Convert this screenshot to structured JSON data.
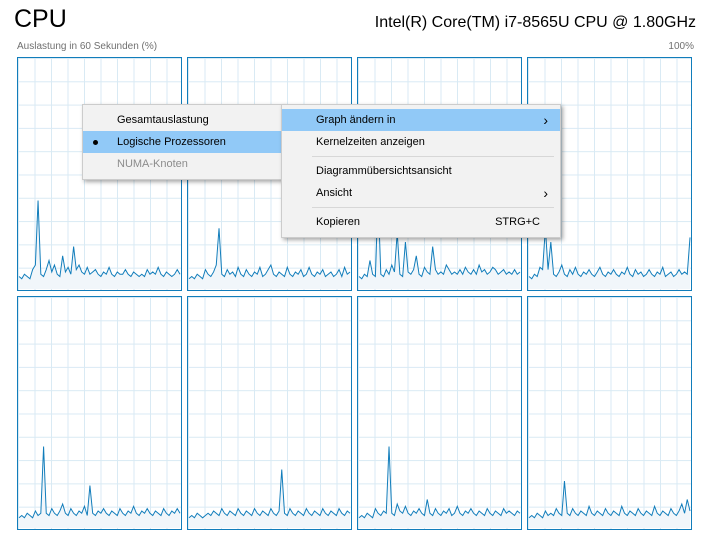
{
  "header": {
    "title": "CPU",
    "cpu_model": "Intel(R) Core(TM) i7-8565U CPU @ 1.80GHz",
    "axis_label": "Auslastung in 60 Sekunden (%)",
    "axis_max": "100%"
  },
  "colors": {
    "graph_line": "#117dbb",
    "graph_fill": "#f1f6fa",
    "grid": "#d9eaf4",
    "menu_highlight": "#91c9f7"
  },
  "graphs": {
    "count": 8,
    "columns": 4,
    "series": [
      [
        5,
        4,
        6,
        5,
        4,
        8,
        10,
        38,
        6,
        5,
        8,
        12,
        7,
        10,
        6,
        5,
        14,
        7,
        9,
        6,
        18,
        8,
        10,
        7,
        6,
        9,
        6,
        7,
        8,
        6,
        5,
        7,
        6,
        9,
        6,
        5,
        7,
        6,
        6,
        8,
        6,
        5,
        7,
        6,
        5,
        6,
        5,
        8,
        6,
        7,
        6,
        9,
        6,
        5,
        7,
        6,
        5,
        6,
        8,
        6
      ],
      [
        4,
        5,
        4,
        6,
        5,
        4,
        8,
        6,
        5,
        7,
        10,
        26,
        6,
        5,
        8,
        6,
        7,
        5,
        9,
        6,
        5,
        8,
        6,
        5,
        7,
        6,
        9,
        5,
        6,
        8,
        10,
        6,
        5,
        7,
        6,
        5,
        9,
        6,
        5,
        7,
        6,
        8,
        5,
        6,
        9,
        6,
        5,
        7,
        6,
        8,
        5,
        6,
        7,
        5,
        6,
        8,
        5,
        9,
        6,
        7
      ],
      [
        5,
        4,
        6,
        5,
        12,
        6,
        5,
        40,
        6,
        5,
        8,
        6,
        10,
        7,
        24,
        6,
        5,
        20,
        7,
        6,
        8,
        14,
        6,
        5,
        9,
        7,
        6,
        18,
        8,
        6,
        7,
        6,
        10,
        8,
        6,
        7,
        6,
        8,
        6,
        9,
        7,
        6,
        8,
        6,
        10,
        7,
        8,
        6,
        7,
        9,
        8,
        6,
        7,
        8,
        6,
        7,
        6,
        8,
        6,
        7
      ],
      [
        5,
        4,
        6,
        5,
        9,
        8,
        26,
        8,
        20,
        6,
        5,
        7,
        10,
        6,
        5,
        8,
        6,
        9,
        6,
        5,
        7,
        6,
        8,
        6,
        5,
        7,
        9,
        6,
        5,
        7,
        6,
        8,
        6,
        5,
        7,
        6,
        9,
        6,
        5,
        8,
        6,
        7,
        5,
        6,
        8,
        6,
        5,
        7,
        6,
        9,
        5,
        6,
        7,
        5,
        6,
        8,
        6,
        7,
        6,
        22
      ],
      [
        4,
        5,
        4,
        6,
        5,
        4,
        7,
        5,
        6,
        35,
        6,
        5,
        8,
        6,
        5,
        7,
        10,
        6,
        5,
        8,
        6,
        5,
        7,
        6,
        9,
        5,
        18,
        6,
        5,
        7,
        6,
        8,
        6,
        5,
        7,
        6,
        5,
        8,
        6,
        5,
        7,
        6,
        9,
        6,
        5,
        7,
        6,
        8,
        6,
        5,
        7,
        6,
        5,
        8,
        6,
        5,
        7,
        6,
        8,
        6
      ],
      [
        4,
        5,
        4,
        6,
        5,
        4,
        5,
        6,
        5,
        7,
        6,
        5,
        8,
        6,
        5,
        7,
        6,
        5,
        8,
        6,
        5,
        7,
        6,
        5,
        8,
        6,
        5,
        7,
        6,
        5,
        8,
        6,
        5,
        7,
        25,
        6,
        5,
        8,
        6,
        5,
        7,
        6,
        5,
        8,
        6,
        5,
        7,
        6,
        5,
        8,
        6,
        5,
        7,
        6,
        5,
        8,
        6,
        5,
        7,
        6
      ],
      [
        4,
        5,
        4,
        6,
        5,
        4,
        8,
        6,
        5,
        7,
        6,
        35,
        6,
        5,
        10,
        7,
        6,
        9,
        6,
        5,
        7,
        6,
        8,
        6,
        5,
        12,
        6,
        5,
        8,
        6,
        5,
        7,
        6,
        8,
        5,
        6,
        9,
        6,
        5,
        7,
        6,
        8,
        6,
        5,
        7,
        6,
        5,
        8,
        6,
        5,
        7,
        6,
        5,
        8,
        6,
        7,
        6,
        5,
        7,
        6
      ],
      [
        4,
        5,
        4,
        6,
        5,
        4,
        7,
        5,
        6,
        5,
        8,
        6,
        5,
        20,
        6,
        5,
        8,
        6,
        5,
        7,
        6,
        5,
        9,
        6,
        5,
        7,
        6,
        5,
        8,
        6,
        5,
        7,
        6,
        5,
        9,
        6,
        5,
        7,
        6,
        5,
        8,
        6,
        5,
        7,
        6,
        5,
        9,
        6,
        5,
        7,
        6,
        5,
        8,
        6,
        5,
        7,
        10,
        6,
        12,
        7
      ]
    ]
  },
  "menu_main": {
    "items": [
      {
        "label": "Graph ändern in",
        "submenu": true,
        "highlighted": true
      },
      {
        "label": "Kernelzeiten anzeigen"
      },
      {
        "separator": true
      },
      {
        "label": "Diagrammübersichtsansicht"
      },
      {
        "label": "Ansicht",
        "submenu": true
      },
      {
        "separator": true
      },
      {
        "label": "Kopieren",
        "shortcut": "STRG+C"
      }
    ]
  },
  "menu_sub": {
    "items": [
      {
        "label": "Gesamtauslastung"
      },
      {
        "label": "Logische Prozessoren",
        "selected": true,
        "highlighted": true
      },
      {
        "label": "NUMA-Knoten",
        "disabled": true
      }
    ]
  }
}
